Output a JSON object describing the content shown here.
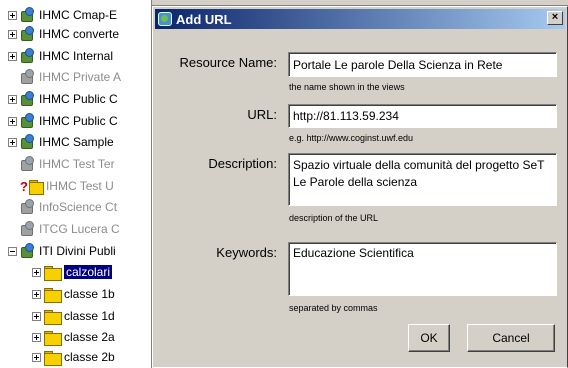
{
  "tree": {
    "items": [
      {
        "label": "IHMC Cmap-E",
        "kind": "pkg",
        "disabled": false,
        "expander": "plus"
      },
      {
        "label": "IHMC converte",
        "kind": "pkg",
        "disabled": false,
        "expander": "plus"
      },
      {
        "label": "IHMC Internal",
        "kind": "pkg",
        "disabled": false,
        "expander": "plus"
      },
      {
        "label": "IHMC Private A",
        "kind": "pkg-gray",
        "disabled": true,
        "expander": ""
      },
      {
        "label": "IHMC Public C",
        "kind": "pkg",
        "disabled": false,
        "expander": "plus"
      },
      {
        "label": "IHMC Public C",
        "kind": "pkg",
        "disabled": false,
        "expander": "plus"
      },
      {
        "label": "IHMC Sample",
        "kind": "pkg",
        "disabled": false,
        "expander": "plus"
      },
      {
        "label": "IHMC Test Ter",
        "kind": "pkg-gray",
        "disabled": true,
        "expander": ""
      },
      {
        "label": "IHMC Test U",
        "kind": "unknown",
        "disabled": true,
        "expander": ""
      },
      {
        "label": "InfoScience Ct",
        "kind": "pkg-gray",
        "disabled": true,
        "expander": ""
      },
      {
        "label": "ITCG Lucera C",
        "kind": "pkg-gray",
        "disabled": true,
        "expander": ""
      },
      {
        "label": "ITI Divini Publi",
        "kind": "pkg",
        "disabled": false,
        "expander": "minus"
      }
    ],
    "children": [
      {
        "label": "calzolari",
        "selected": true
      },
      {
        "label": "classe 1b",
        "selected": false
      },
      {
        "label": "classe 1d",
        "selected": false
      },
      {
        "label": "classe 2a",
        "selected": false
      },
      {
        "label": "classe 2b",
        "selected": false
      }
    ]
  },
  "dialog": {
    "title": "Add URL",
    "close_label": "×",
    "resource_name": {
      "label": "Resource Name:",
      "value": "Portale Le parole Della Scienza in Rete",
      "hint": "the name shown in the views"
    },
    "url": {
      "label": "URL:",
      "value": "http://81.113.59.234",
      "hint": "e.g. http://www.coginst.uwf.edu"
    },
    "description": {
      "label": "Description:",
      "value": "Spazio virtuale della comunità del progetto SeT Le Parole della scienza",
      "hint": "description of the URL"
    },
    "keywords": {
      "label": "Keywords:",
      "value": "Educazione Scientifica",
      "hint": "separated by commas"
    },
    "ok_label": "OK",
    "cancel_label": "Cancel"
  }
}
